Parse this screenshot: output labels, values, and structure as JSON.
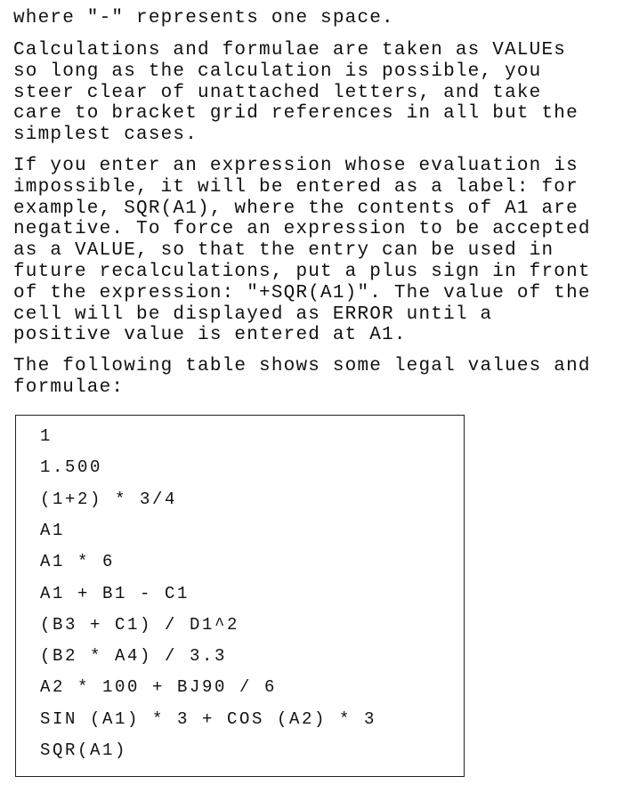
{
  "paragraphs": [
    {
      "lines": [
        "where \"-\" represents one space."
      ]
    },
    {
      "lines": [
        "Calculations and formulae are taken as VALUEs",
        "so long as the calculation is possible, you",
        "steer clear of unattached letters, and take",
        "care to bracket grid references in all but the",
        "simplest cases."
      ]
    },
    {
      "lines": [
        "If you enter an expression whose evaluation is",
        "impossible, it will be entered as a label: for",
        "example, SQR(A1), where the contents of A1 are",
        "negative. To force an expression to be accepted",
        "as a VALUE, so that the entry can be used in",
        "future recalculations, put a plus sign in front",
        "of the expression: \"+SQR(A1)\". The value of the",
        "cell will be displayed as ERROR until a",
        "positive value is entered at A1."
      ]
    },
    {
      "lines": [
        "The following table shows some legal values and",
        "formulae:"
      ]
    }
  ],
  "examples": [
    "1",
    "1.500",
    "(1+2) * 3/4",
    "A1",
    "A1 * 6",
    "A1 + B1 - C1",
    "(B3 + C1) / D1^2",
    "(B2 * A4) / 3.3",
    "A2 * 100 + BJ90 / 6",
    "SIN (A1) * 3 + COS (A2) * 3",
    "SQR(A1)"
  ]
}
